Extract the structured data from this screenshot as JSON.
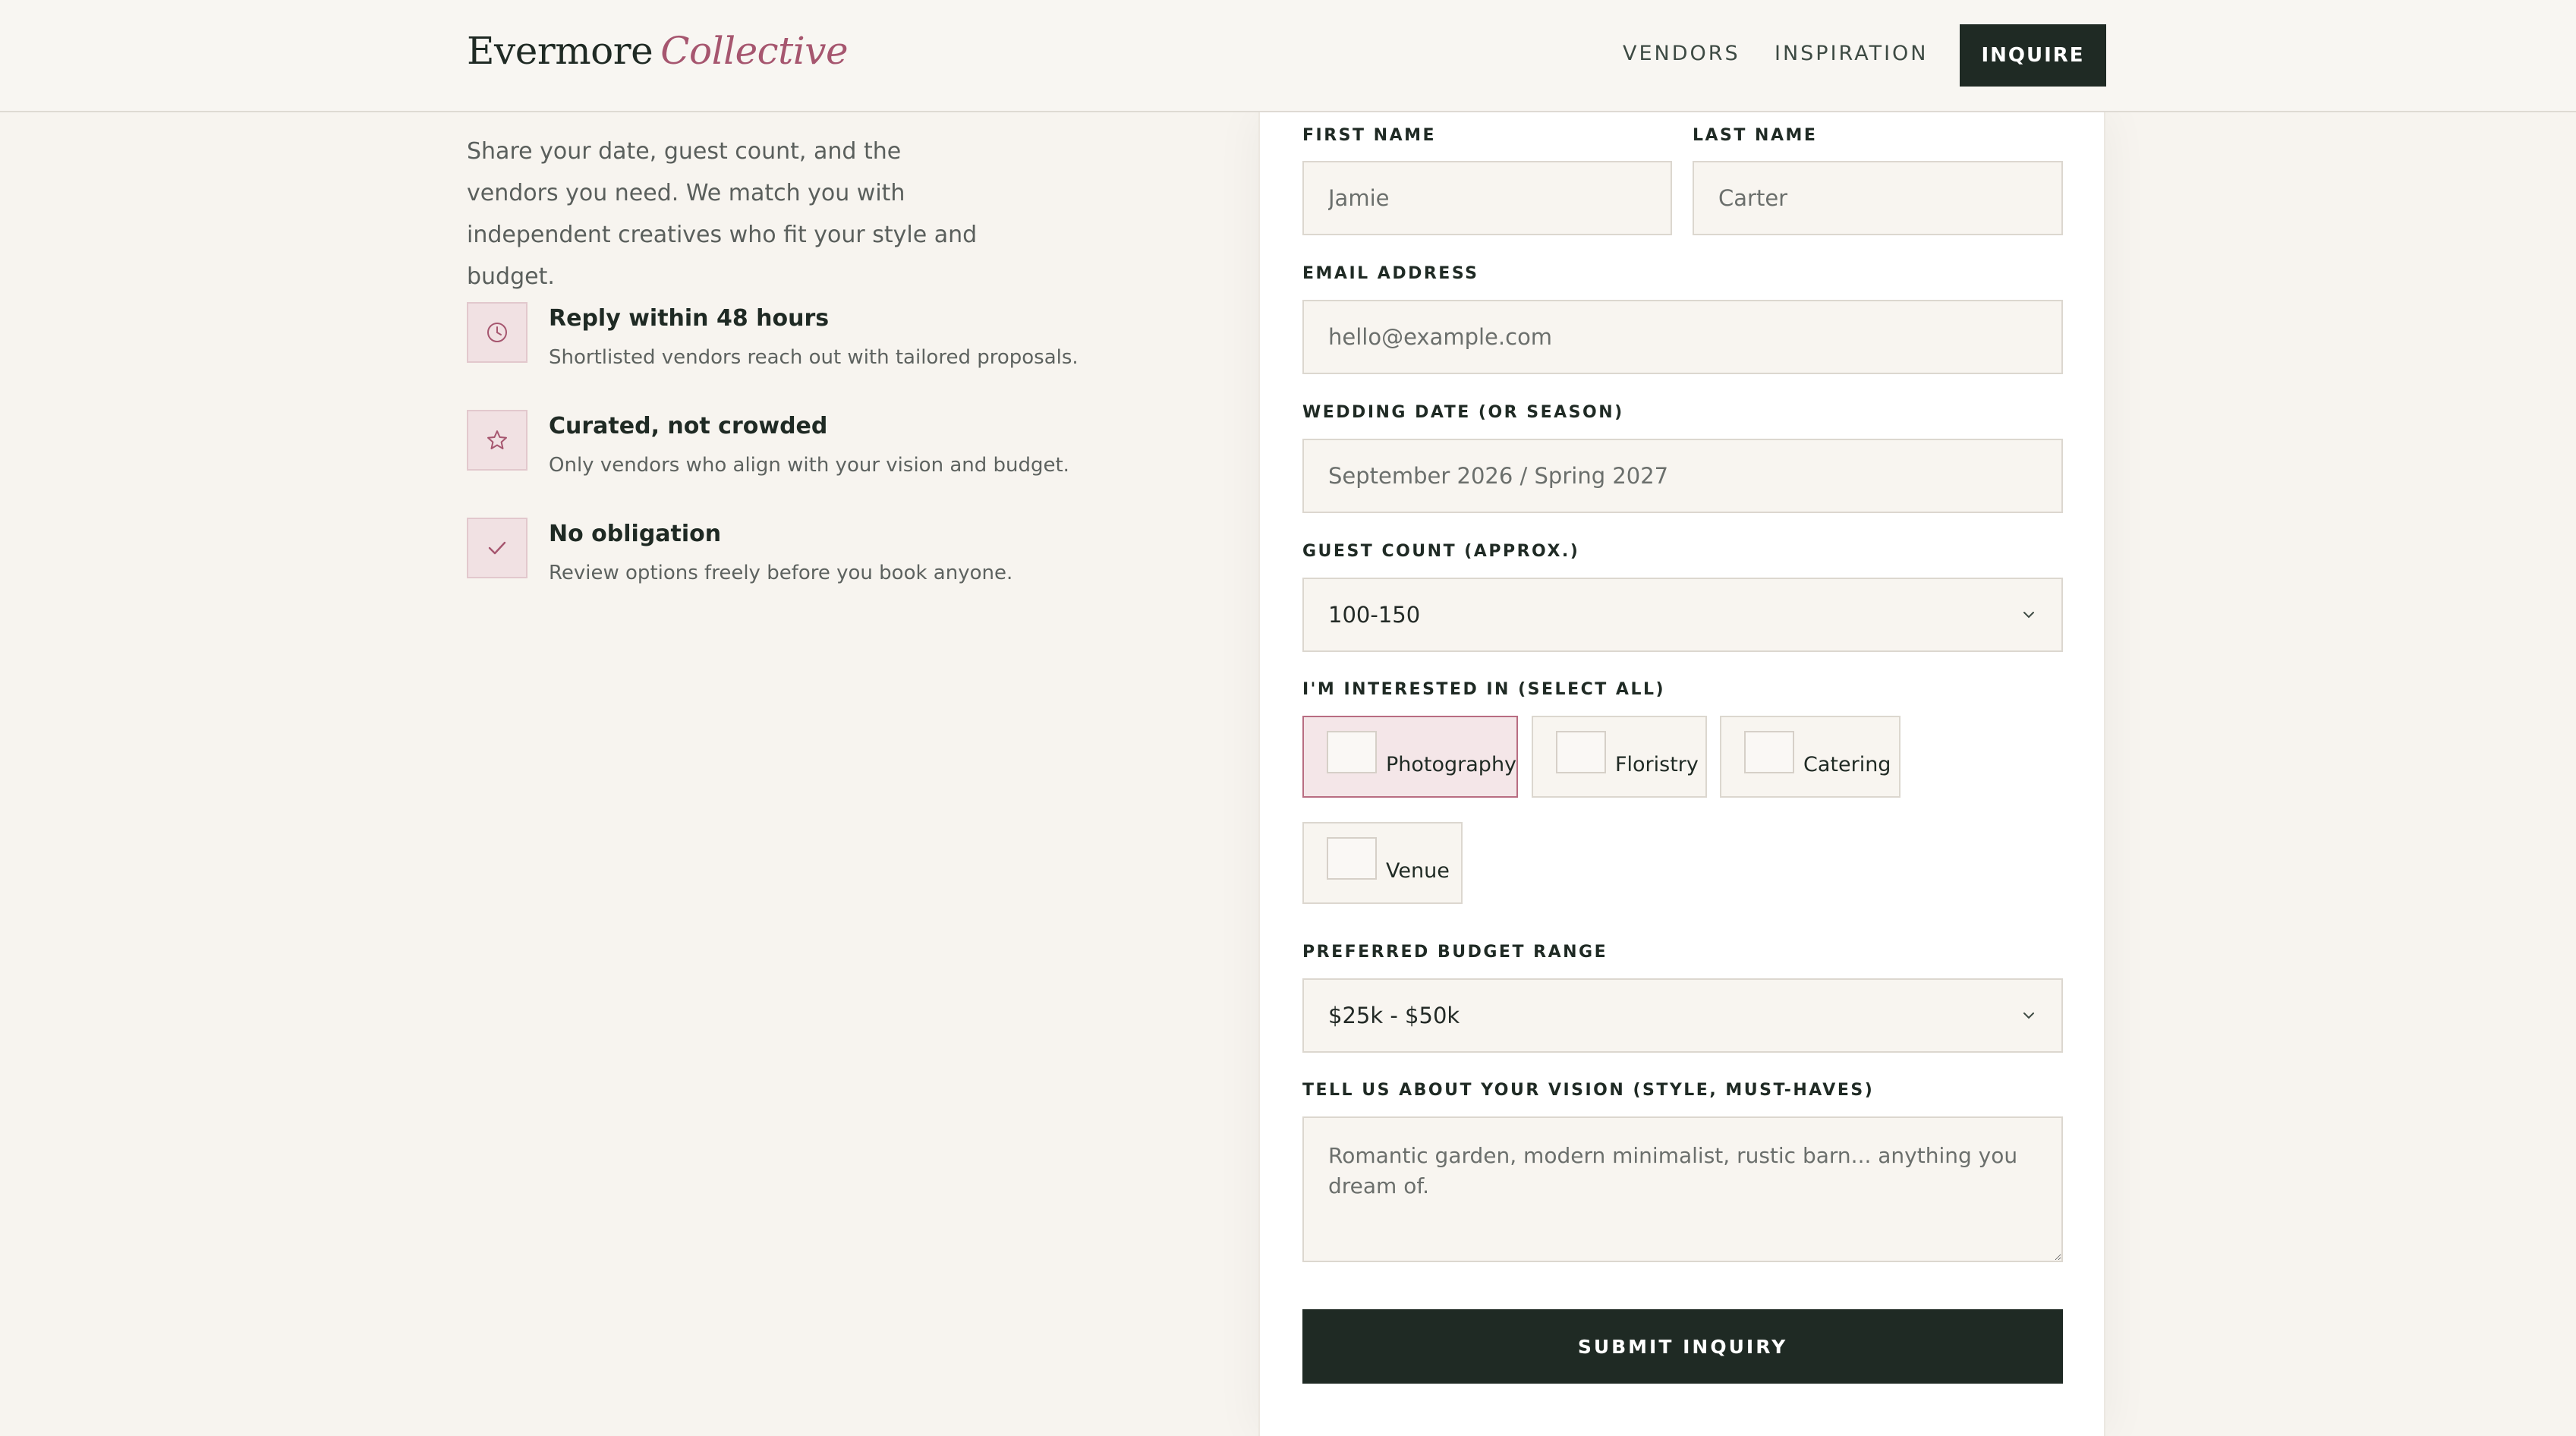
{
  "header": {
    "brand_main": "Evermore",
    "brand_accent": "Collective",
    "nav": [
      "VENDORS",
      "INSPIRATION"
    ],
    "cta_label": "INQUIRE"
  },
  "intro": {
    "text": "Share your date, guest count, and the vendors you need. We match you with independent creatives who fit your style and budget."
  },
  "features": [
    {
      "icon": "clock-icon",
      "title": "Reply within 48 hours",
      "description": "Shortlisted vendors reach out with tailored proposals."
    },
    {
      "icon": "star-icon",
      "title": "Curated, not crowded",
      "description": "Only vendors who align with your vision and budget."
    },
    {
      "icon": "check-icon",
      "title": "No obligation",
      "description": "Review options freely before you book anyone."
    }
  ],
  "form": {
    "first_name": {
      "label": "FIRST NAME",
      "placeholder": "Jamie"
    },
    "last_name": {
      "label": "LAST NAME",
      "placeholder": "Carter"
    },
    "email": {
      "label": "EMAIL ADDRESS",
      "placeholder": "hello@example.com"
    },
    "wedding_date": {
      "label": "WEDDING DATE (OR SEASON)",
      "placeholder": "September 2026 / Spring 2027"
    },
    "guest_count": {
      "label": "GUEST COUNT (APPROX.)",
      "value": "100-150"
    },
    "interests": {
      "label": "I'M INTERESTED IN (SELECT ALL)",
      "options": [
        {
          "label": "Photography",
          "selected": true
        },
        {
          "label": "Floristry",
          "selected": false
        },
        {
          "label": "Catering",
          "selected": false
        },
        {
          "label": "Venue",
          "selected": false
        }
      ]
    },
    "budget": {
      "label": "PREFERRED BUDGET RANGE",
      "value": "$25k - $50k"
    },
    "vision": {
      "label": "TELL US ABOUT YOUR VISION (STYLE, MUST-HAVES)",
      "placeholder": "Romantic garden, modern minimalist, rustic barn... anything you dream of."
    },
    "submit_label": "SUBMIT INQUIRY"
  },
  "colors": {
    "background": "#f7f4ef",
    "ink": "#1f2a24",
    "accent": "#a6566f",
    "field": "#f8f5f0",
    "selected_chip": "#f4e6e8"
  }
}
